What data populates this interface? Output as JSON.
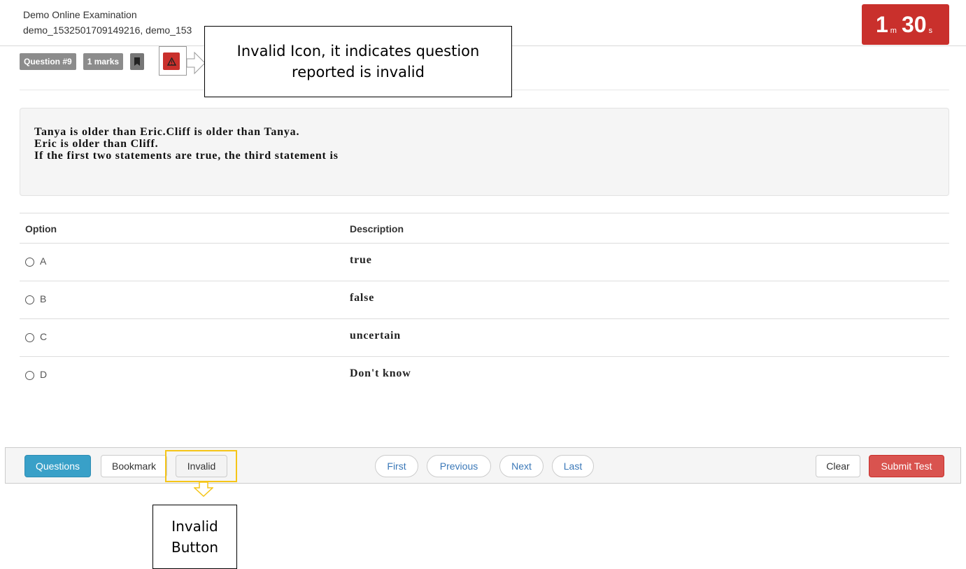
{
  "header": {
    "exam_title": "Demo Online Examination",
    "exam_code": "demo_1532501709149216, demo_153",
    "timer": {
      "minutes": "1",
      "minutes_unit": "m",
      "seconds": "30",
      "seconds_unit": "s"
    }
  },
  "meta": {
    "question_label": "Question #9",
    "marks_label": "1 marks",
    "bookmark_icon": "bookmark-icon",
    "invalid_icon": "warning-triangle-icon"
  },
  "annotations": {
    "invalid_icon_note": "Invalid Icon, it indicates question reported is invalid",
    "invalid_button_note": "Invalid Button"
  },
  "question": {
    "lines": [
      "Tanya is older than Eric.Cliff is older than Tanya.",
      "Eric is older than Cliff.",
      "If the first two statements are true, the third statement is"
    ]
  },
  "options_table": {
    "headers": {
      "option": "Option",
      "description": "Description"
    },
    "rows": [
      {
        "option": "A",
        "description": "true"
      },
      {
        "option": "B",
        "description": "false"
      },
      {
        "option": "C",
        "description": "uncertain"
      },
      {
        "option": "D",
        "description": "Don't know"
      }
    ]
  },
  "toolbar": {
    "questions": "Questions",
    "bookmark": "Bookmark",
    "invalid": "Invalid",
    "first": "First",
    "previous": "Previous",
    "next": "Next",
    "last": "Last",
    "clear": "Clear",
    "submit": "Submit Test"
  },
  "colors": {
    "timer_bg": "#c9302c",
    "primary": "#39a0c8",
    "danger": "#d9534f",
    "highlight": "#f5c518"
  }
}
